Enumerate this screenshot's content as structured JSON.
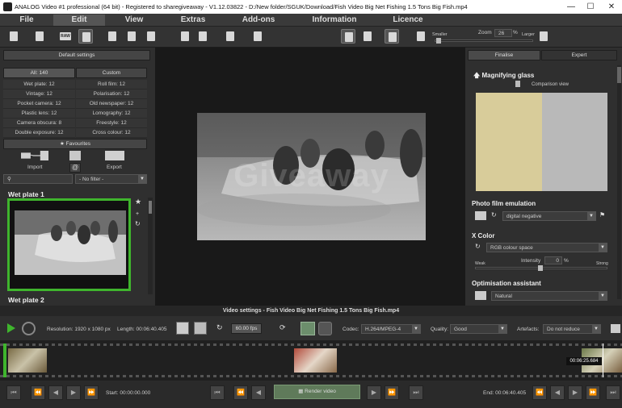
{
  "window": {
    "title": "ANALOG Video #1 professional (64 bit) - Registered to sharegiveaway - V1.12.03822 - D:/New folder/SGUK/Download/Fish Video Big Net Fishing 1.5 Tons Big Fish.mp4",
    "minimize": "—",
    "maximize": "☐",
    "close": "✕"
  },
  "menu": [
    "File",
    "Edit",
    "View",
    "Extras",
    "Add-ons",
    "Information",
    "Licence"
  ],
  "toolbar": {
    "zoom_label": "Zoom",
    "zoom_value": "26",
    "zoom_unit": "%",
    "smaller": "Smaller",
    "larger": "Larger"
  },
  "left": {
    "default_settings": "Default settings",
    "tab_all": "All: 140",
    "tab_custom": "Custom",
    "categories": [
      "Wet plate: 12",
      "Roll film: 12",
      "Vintage: 12",
      "Polarisation: 12",
      "Pocket camera: 12",
      "Old newspaper: 12",
      "Plastic lens: 12",
      "Lomography: 12",
      "Camera obscura: 8",
      "Freestyle: 12",
      "Double exposure: 12",
      "Cross colour: 12"
    ],
    "favourites": "Favourites",
    "import": "Import",
    "export": "Export",
    "filter_value": "- No filter -",
    "preset1_title": "Wet plate 1",
    "preset2_title": "Wet plate 2"
  },
  "right": {
    "tab_finalise": "Finalise",
    "tab_expert": "Expert",
    "magnifying": "Magnifying glass",
    "comparison": "Comparison view",
    "photo_film": "Photo film emulation",
    "film_value": "digital negative",
    "xcolor": "X Color",
    "color_space": "RGB colour space",
    "intensity_label": "Intensity",
    "intensity_value": "0",
    "intensity_unit": "%",
    "weak": "Weak",
    "strong": "Strong",
    "optimisation": "Optimisation assistant",
    "opt_value": "Natural"
  },
  "video_settings": "Video settings - Fish Video Big Net Fishing 1.5 Tons Big Fish.mp4",
  "controls": {
    "resolution": "Resolution: 1920 x 1080 px",
    "length": "Length: 00:06:40.405",
    "fps": "60.00 fps",
    "codec_label": "Codec:",
    "codec_value": "H.264/MPEG-4",
    "quality_label": "Quality:",
    "quality_value": "Good",
    "artefacts_label": "Artefacts:",
    "artefacts_value": "Do not reduce"
  },
  "timeline": {
    "timecode": "00:06:25.684",
    "playhead_fraction": 0.969
  },
  "bottom": {
    "start": "Start: 00:00:00.000",
    "render": "Render video",
    "end": "End: 00:06:40.405"
  },
  "watermark": "Giveaway",
  "colors": {
    "accent_green": "#3fb52d",
    "render_bg": "#5f7a5a",
    "finalise_tab": "#4a4a4a"
  }
}
